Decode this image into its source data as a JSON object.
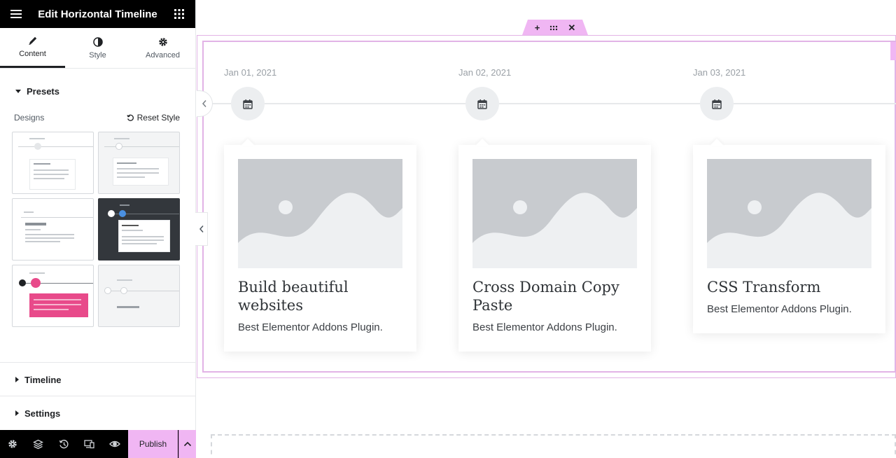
{
  "header": {
    "title": "Edit Horizontal Timeline",
    "menu_icon": "hamburger-icon",
    "grid_icon": "apps-grid-icon"
  },
  "tabs": [
    {
      "label": "Content",
      "icon": "pencil-icon",
      "active": true
    },
    {
      "label": "Style",
      "icon": "contrast-icon",
      "active": false
    },
    {
      "label": "Advanced",
      "icon": "gear-icon",
      "active": false
    }
  ],
  "presets": {
    "title": "Presets",
    "designs_label": "Designs",
    "reset_label": "Reset Style"
  },
  "sections": {
    "timeline": "Timeline",
    "settings": "Settings"
  },
  "footer": {
    "publish_label": "Publish",
    "tools": [
      "settings-icon",
      "layers-icon",
      "history-icon",
      "responsive-icon",
      "preview-icon"
    ]
  },
  "colors": {
    "accent_pink": "#f0b6f3",
    "outline_pink": "#e2b3e6",
    "header_black": "#000000"
  },
  "timeline": {
    "items": [
      {
        "date": "Jan 01, 2021",
        "title": "Build beautiful websites",
        "description": "Best Elementor Addons Plugin."
      },
      {
        "date": "Jan 02, 2021",
        "title": "Cross Domain Copy Paste",
        "description": "Best Elementor Addons Plugin."
      },
      {
        "date": "Jan 03, 2021",
        "title": "CSS Transform",
        "description": "Best Elementor Addons Plugin."
      }
    ]
  }
}
